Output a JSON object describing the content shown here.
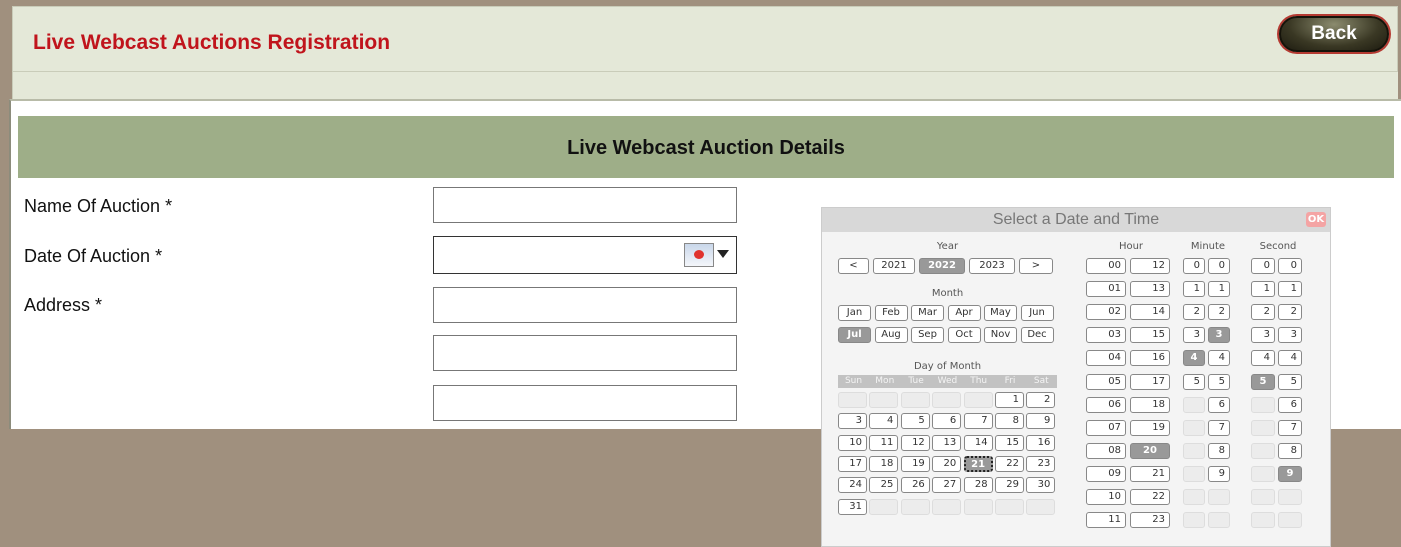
{
  "header": {
    "title": "Live Webcast Auctions Registration",
    "back_label": "Back"
  },
  "section": {
    "title": "Live Webcast Auction Details"
  },
  "form": {
    "name_label": "Name Of Auction *",
    "date_label": "Date Of Auction *",
    "address_label": "Address *"
  },
  "picker": {
    "title": "Select a Date and Time",
    "ok_label": "OK",
    "year_caption": "Year",
    "month_caption": "Month",
    "dom_caption": "Day of Month",
    "hour_caption": "Hour",
    "minute_caption": "Minute",
    "second_caption": "Second",
    "year_buttons": [
      "<",
      "2021",
      "2022",
      "2023",
      ">"
    ],
    "selected_year": "2022",
    "months": [
      "Jan",
      "Feb",
      "Mar",
      "Apr",
      "May",
      "Jun",
      "Jul",
      "Aug",
      "Sep",
      "Oct",
      "Nov",
      "Dec"
    ],
    "selected_month": "Jul",
    "weekdays": [
      "Sun",
      "Mon",
      "Tue",
      "Wed",
      "Thu",
      "Fri",
      "Sat"
    ],
    "day_rows": [
      [
        "",
        "",
        "",
        "",
        "",
        "1",
        "2"
      ],
      [
        "3",
        "4",
        "5",
        "6",
        "7",
        "8",
        "9"
      ],
      [
        "10",
        "11",
        "12",
        "13",
        "14",
        "15",
        "16"
      ],
      [
        "17",
        "18",
        "19",
        "20",
        "21",
        "22",
        "23"
      ],
      [
        "24",
        "25",
        "26",
        "27",
        "28",
        "29",
        "30"
      ],
      [
        "31",
        "",
        "",
        "",
        "",
        "",
        ""
      ]
    ],
    "selected_day": "21",
    "hour_rows": [
      [
        "00",
        "12"
      ],
      [
        "01",
        "13"
      ],
      [
        "02",
        "14"
      ],
      [
        "03",
        "15"
      ],
      [
        "04",
        "16"
      ],
      [
        "05",
        "17"
      ],
      [
        "06",
        "18"
      ],
      [
        "07",
        "19"
      ],
      [
        "08",
        "20"
      ],
      [
        "09",
        "21"
      ],
      [
        "10",
        "22"
      ],
      [
        "11",
        "23"
      ]
    ],
    "selected_hour": "20",
    "minute_rows": [
      [
        "0",
        "0"
      ],
      [
        "1",
        "1"
      ],
      [
        "2",
        "2"
      ],
      [
        "3",
        "3"
      ],
      [
        "4",
        "4"
      ],
      [
        "5",
        "5"
      ],
      [
        "",
        "6"
      ],
      [
        "",
        "7"
      ],
      [
        "",
        "8"
      ],
      [
        "",
        "9"
      ],
      [
        "",
        ""
      ],
      [
        "",
        ""
      ]
    ],
    "selected_minute_tens": "4",
    "selected_minute_ones": "3",
    "second_rows": [
      [
        "0",
        "0"
      ],
      [
        "1",
        "1"
      ],
      [
        "2",
        "2"
      ],
      [
        "3",
        "3"
      ],
      [
        "4",
        "4"
      ],
      [
        "5",
        "5"
      ],
      [
        "",
        "6"
      ],
      [
        "",
        "7"
      ],
      [
        "",
        "8"
      ],
      [
        "",
        "9"
      ],
      [
        "",
        ""
      ],
      [
        "",
        ""
      ]
    ],
    "selected_second_tens": "5",
    "selected_second_ones": "9"
  }
}
